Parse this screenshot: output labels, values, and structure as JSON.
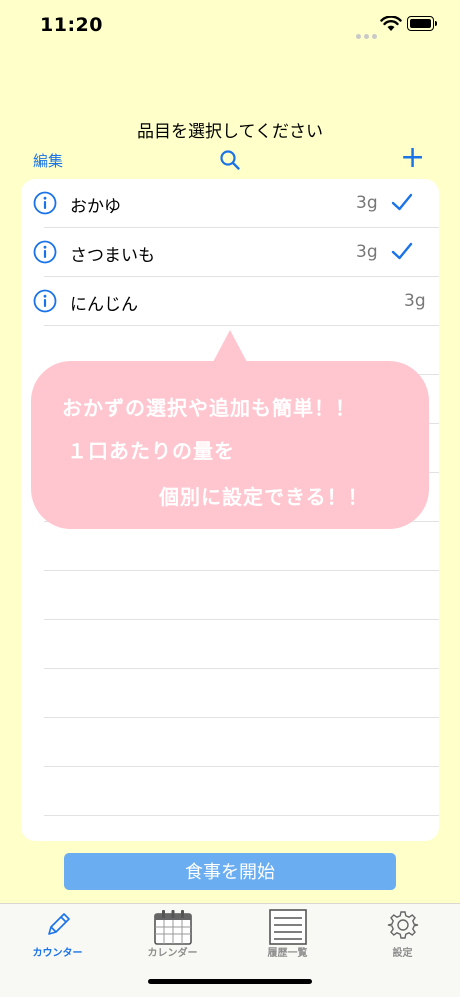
{
  "status": {
    "time": "11:20"
  },
  "nav": {
    "title": "品目を選択してください",
    "edit_label": "編集",
    "add_label": "+"
  },
  "items": [
    {
      "name": "おかゆ",
      "amount": "3g",
      "checked": true
    },
    {
      "name": "さつまいも",
      "amount": "3g",
      "checked": true
    },
    {
      "name": "にんじん",
      "amount": "3g",
      "checked": false
    }
  ],
  "callout": {
    "line1": "おかずの選択や追加も簡単！！",
    "line2": "１口あたりの量を",
    "line3": "個別に設定できる！！"
  },
  "start_button": {
    "label": "食事を開始"
  },
  "tabs": [
    {
      "label": "カウンター",
      "icon": "pencil-icon",
      "active": true
    },
    {
      "label": "カレンダー",
      "icon": "calendar-icon",
      "active": false
    },
    {
      "label": "履歴一覧",
      "icon": "list-icon",
      "active": false
    },
    {
      "label": "設定",
      "icon": "gear-icon",
      "active": false
    }
  ],
  "colors": {
    "accent": "#1a73e8",
    "background": "#ffffc9",
    "callout": "#ffc6d0",
    "button": "#6aaef1"
  }
}
